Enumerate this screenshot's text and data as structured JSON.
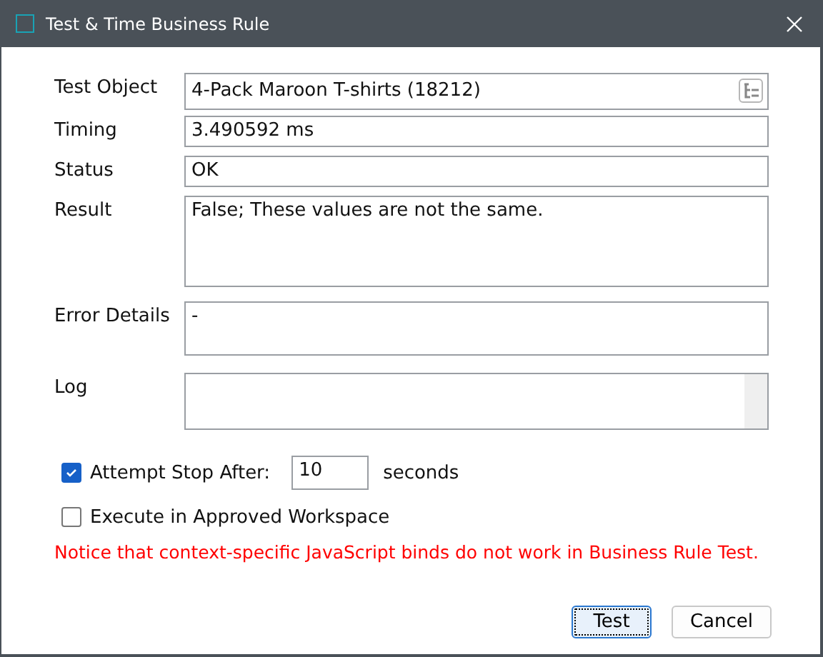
{
  "window": {
    "title": "Test & Time Business Rule"
  },
  "fields": [
    {
      "label": "Test Object",
      "value": "4-Pack Maroon T-shirts (18212)",
      "kind": "picker"
    },
    {
      "label": "Timing",
      "value": "3.490592 ms",
      "kind": "line"
    },
    {
      "label": "Status",
      "value": "OK",
      "kind": "line"
    },
    {
      "label": "Result",
      "value": "False; These values are not the same.",
      "kind": "area"
    },
    {
      "label": "Error Details",
      "value": "-",
      "kind": "box"
    },
    {
      "label": "Log",
      "kind": "log"
    }
  ],
  "attempt_stop": {
    "label": "Attempt Stop After:",
    "checked": true,
    "value": "10",
    "unit": "seconds"
  },
  "approved_workspace": {
    "label": "Execute in Approved Workspace",
    "checked": false
  },
  "notice": "Notice that context-specific JavaScript binds do not work in Business Rule Test.",
  "buttons": [
    {
      "label": "Test",
      "default": true
    },
    {
      "label": "Cancel",
      "default": false
    }
  ]
}
